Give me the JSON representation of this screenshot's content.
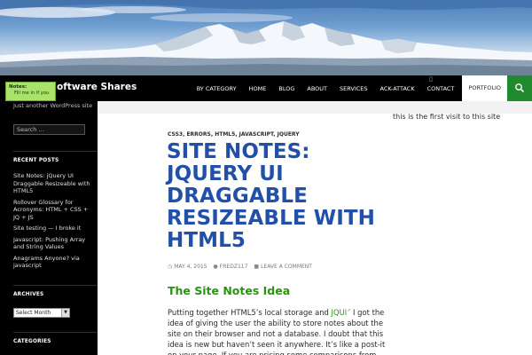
{
  "header": {
    "site_title": "oftware Shares",
    "colors": {
      "nav_bg": "#000000",
      "accent_green": "#1f8b2e",
      "title_blue": "#2250a8",
      "heading_green": "#2a9412"
    }
  },
  "nav": {
    "items": [
      {
        "label": "BY CATEGORY"
      },
      {
        "label": "HOME"
      },
      {
        "label": "BLOG"
      },
      {
        "label": "ABOUT"
      },
      {
        "label": "SERVICES"
      },
      {
        "label": "ACK-ATTACK"
      },
      {
        "label": "CONTACT"
      },
      {
        "label": "PORTFOLIO"
      }
    ],
    "search_icon": "search-icon"
  },
  "sticky_note": {
    "title": "Notes:",
    "body": "Fill me in if you"
  },
  "sidebar": {
    "tagline": "Just another WordPress site",
    "search_placeholder": "Search …",
    "recent_posts_title": "RECENT POSTS",
    "recent_posts": [
      "Site Notes: jQuery UI Draggable Resizeable with HTML5",
      "Rollover Glossary for Acronyms: HTML + CSS + JQ + JS",
      "Site testing — I broke it",
      "Javascript: Pushing Array and String Values",
      "Anagrams Anyone? via javascript"
    ],
    "archives_title": "ARCHIVES",
    "archives_selected": "Select Month",
    "categories_title": "CATEGORIES"
  },
  "main": {
    "first_visit": "this is the first visit to this site",
    "categories": [
      "CSS3",
      "ERRORS",
      "HTML5",
      "JAVASCRIPT",
      "JQUERY"
    ],
    "post_title": "SITE NOTES: JQUERY UI DRAGGABLE RESIZEABLE WITH HTML5",
    "meta": {
      "date": "MAY 4, 2015",
      "author": "FREDZ117",
      "comment": "LEAVE A COMMENT"
    },
    "section_heading": "The Site Notes Idea",
    "body": {
      "part1": "Putting together HTML5’s local storage and ",
      "link": "JQUI",
      "part2": " I got the idea of giving the user the ability to store notes about the site on their browser and not a database.   I doubt that this idea is new but haven’t seen it anywhere.  It’s like a post-it on your page.  If you are pricing some comparisons from"
    }
  }
}
